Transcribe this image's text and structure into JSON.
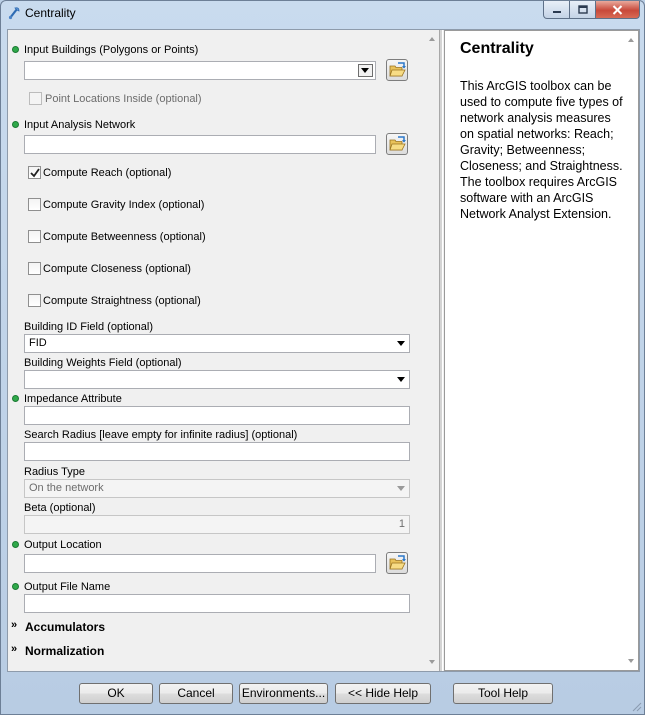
{
  "window": {
    "title": "Centrality"
  },
  "params": {
    "input_buildings": {
      "label": "Input Buildings (Polygons or Points)",
      "value": ""
    },
    "point_locations": {
      "label": "Point Locations Inside (optional)",
      "checked": false
    },
    "input_network": {
      "label": "Input Analysis Network",
      "value": ""
    },
    "compute_reach": {
      "label": "Compute Reach (optional)",
      "checked": true
    },
    "compute_gravity": {
      "label": "Compute Gravity Index (optional)",
      "checked": false
    },
    "compute_betweenness": {
      "label": "Compute Betweenness (optional)",
      "checked": false
    },
    "compute_closeness": {
      "label": "Compute Closeness (optional)",
      "checked": false
    },
    "compute_straightness": {
      "label": "Compute Straightness (optional)",
      "checked": false
    },
    "building_id": {
      "label": "Building ID Field (optional)",
      "value": "FID"
    },
    "building_weights": {
      "label": "Building Weights Field (optional)",
      "value": ""
    },
    "impedance": {
      "label": "Impedance Attribute",
      "value": ""
    },
    "search_radius": {
      "label": "Search Radius [leave empty for infinite radius] (optional)",
      "value": ""
    },
    "radius_type": {
      "label": "Radius Type",
      "value": "On the network"
    },
    "beta": {
      "label": "Beta (optional)",
      "value": "1"
    },
    "output_location": {
      "label": "Output Location",
      "value": ""
    },
    "output_file_name": {
      "label": "Output File Name",
      "value": ""
    }
  },
  "sections": {
    "accumulators": "Accumulators",
    "normalization": "Normalization"
  },
  "help": {
    "title": "Centrality",
    "body": "This ArcGIS toolbox can be used to compute five types of network analysis measures on spatial networks: Reach; Gravity; Betweenness; Closeness; and Straightness. The toolbox requires ArcGIS software with an ArcGIS Network Analyst Extension."
  },
  "buttons": {
    "ok": "OK",
    "cancel": "Cancel",
    "environments": "Environments...",
    "hide_help": "<< Hide Help",
    "tool_help": "Tool Help"
  },
  "colors": {
    "required_dot": "#2fa94a",
    "close_button": "#c8493a"
  }
}
